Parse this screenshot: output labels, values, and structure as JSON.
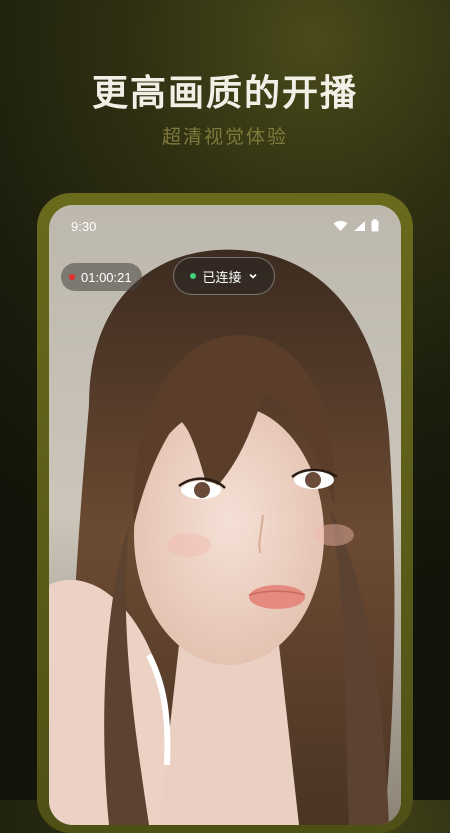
{
  "promo": {
    "headline": "更高画质的开播",
    "subhead": "超清视觉体验"
  },
  "statusbar": {
    "time": "9:30",
    "icons": [
      "wifi-icon",
      "signal-icon",
      "battery-icon"
    ]
  },
  "live": {
    "timer": "01:00:21",
    "connection_status": "已连接",
    "status_color": "#42d07a",
    "record_color": "#e0322c"
  },
  "colors": {
    "accent_frame": "#5d5e1a",
    "subhead": "#7d7a3a"
  }
}
